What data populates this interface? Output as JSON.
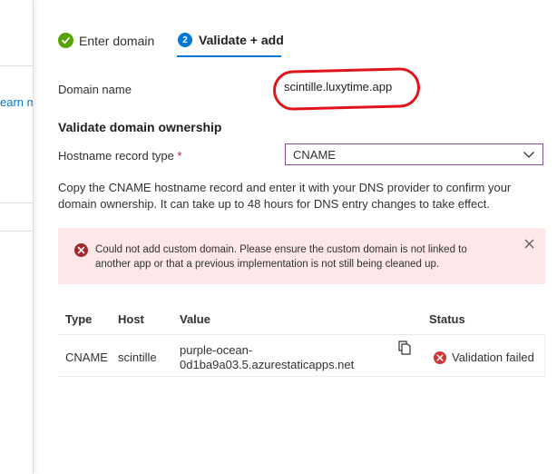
{
  "background": {
    "left_link": "earn m"
  },
  "steps": [
    {
      "label": "Enter domain",
      "state": "done",
      "icon": "check-circle-icon"
    },
    {
      "label": "Validate + add",
      "state": "active",
      "number": "2"
    }
  ],
  "form": {
    "domain_label": "Domain name",
    "domain_value": "scintille.luxytime.app",
    "section_title": "Validate domain ownership",
    "record_type_label": "Hostname record type",
    "required_marker": "*",
    "record_type_value": "CNAME",
    "description": "Copy the CNAME hostname record and enter it with your DNS provider to confirm your domain ownership. It can take up to 48 hours for DNS entry changes to take effect."
  },
  "error": {
    "message": "Could not add custom domain. Please ensure the custom domain is not linked to another app or that a previous implementation is not still being cleaned up."
  },
  "table": {
    "headers": {
      "type": "Type",
      "host": "Host",
      "value": "Value",
      "status": "Status"
    },
    "rows": [
      {
        "type": "CNAME",
        "host": "scintille",
        "value": "purple-ocean-0d1ba9a03.5.azurestaticapps.net",
        "status": "Validation failed"
      }
    ]
  },
  "colors": {
    "accent": "#0078d4",
    "success": "#57a300",
    "error": "#d13438",
    "error_bg": "#fde7e9",
    "annotation": "#e0141a"
  }
}
